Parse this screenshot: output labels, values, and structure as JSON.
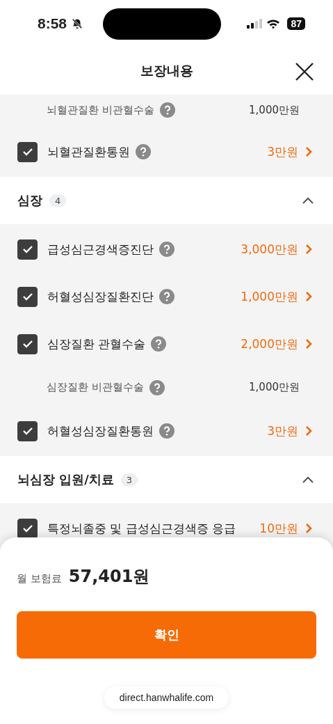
{
  "status_bar": {
    "time": "8:58",
    "battery": "87"
  },
  "header": {
    "title": "보장내용"
  },
  "sections": [
    {
      "rows": [
        {
          "kind": "sub",
          "label": "뇌혈관질환 비관혈수술",
          "help": true,
          "amount": "1,000만원"
        },
        {
          "kind": "coverage",
          "checked": true,
          "label": "뇌혈관질환통원",
          "help": true,
          "amount": "3만원"
        }
      ]
    },
    {
      "title": "심장",
      "count": "4",
      "expanded": true,
      "rows": [
        {
          "kind": "coverage",
          "checked": true,
          "label": "급성심근경색증진단",
          "help": true,
          "amount": "3,000만원"
        },
        {
          "kind": "coverage",
          "checked": true,
          "label": "허혈성심장질환진단",
          "help": true,
          "amount": "1,000만원"
        },
        {
          "kind": "coverage",
          "checked": true,
          "label": "심장질환 관혈수술",
          "help": true,
          "amount": "2,000만원"
        },
        {
          "kind": "sub",
          "label": "심장질환 비관혈수술",
          "help": true,
          "amount": "1,000만원"
        },
        {
          "kind": "coverage",
          "checked": true,
          "label": "허혈성심장질환통원",
          "help": true,
          "amount": "3만원"
        }
      ]
    },
    {
      "title": "뇌심장 입원/치료",
      "count": "3",
      "expanded": true,
      "rows": [
        {
          "kind": "coverage",
          "checked": true,
          "label": "특정뇌졸중 및 급성심근경색증 응급",
          "help": false,
          "amount": "10만원"
        }
      ]
    }
  ],
  "footer": {
    "premium_label": "월 보험료",
    "premium": "57,401원",
    "button": "확인",
    "url": "direct.hanwhalife.com"
  }
}
